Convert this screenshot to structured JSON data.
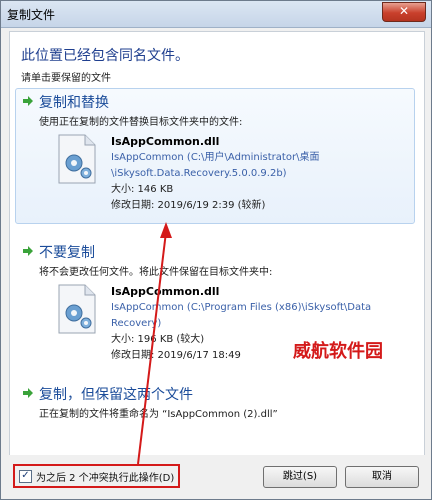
{
  "window": {
    "title": "复制文件",
    "close_glyph": "✕"
  },
  "dialog": {
    "heading": "此位置已经包含同名文件。",
    "subheading": "请单击要保留的文件"
  },
  "options": [
    {
      "title": "复制和替换",
      "description": "使用正在复制的文件替换目标文件夹中的文件:",
      "file": {
        "name": "IsAppCommon.dll",
        "path_line1": "IsAppCommon (C:\\用户\\Administrator\\桌面",
        "path_line2": "\\iSkysoft.Data.Recovery.5.0.0.9.2b)",
        "size": "大小: 146 KB",
        "modified": "修改日期: 2019/6/19 2:39 (较新)"
      }
    },
    {
      "title": "不要复制",
      "description": "将不会更改任何文件。将此文件保留在目标文件夹中:",
      "file": {
        "name": "IsAppCommon.dll",
        "path_line1": "IsAppCommon (C:\\Program Files (x86)\\iSkysoft\\Data",
        "path_line2": "Recovery)",
        "size": "大小: 196 KB (较大)",
        "modified": "修改日期: 2019/6/17 18:49"
      }
    },
    {
      "title": "复制，但保留这两个文件",
      "description": "正在复制的文件将重命名为 “IsAppCommon (2).dll”"
    }
  ],
  "footer": {
    "checkbox_checked": true,
    "checkbox_mark": "✓",
    "checkbox_label": "为之后 2 个冲突执行此操作(D)",
    "skip_button": "跳过(S)",
    "cancel_button": "取消"
  },
  "watermark": "威航软件园",
  "colors": {
    "accent": "#1b4c9a",
    "annotation": "#d41a1a"
  }
}
